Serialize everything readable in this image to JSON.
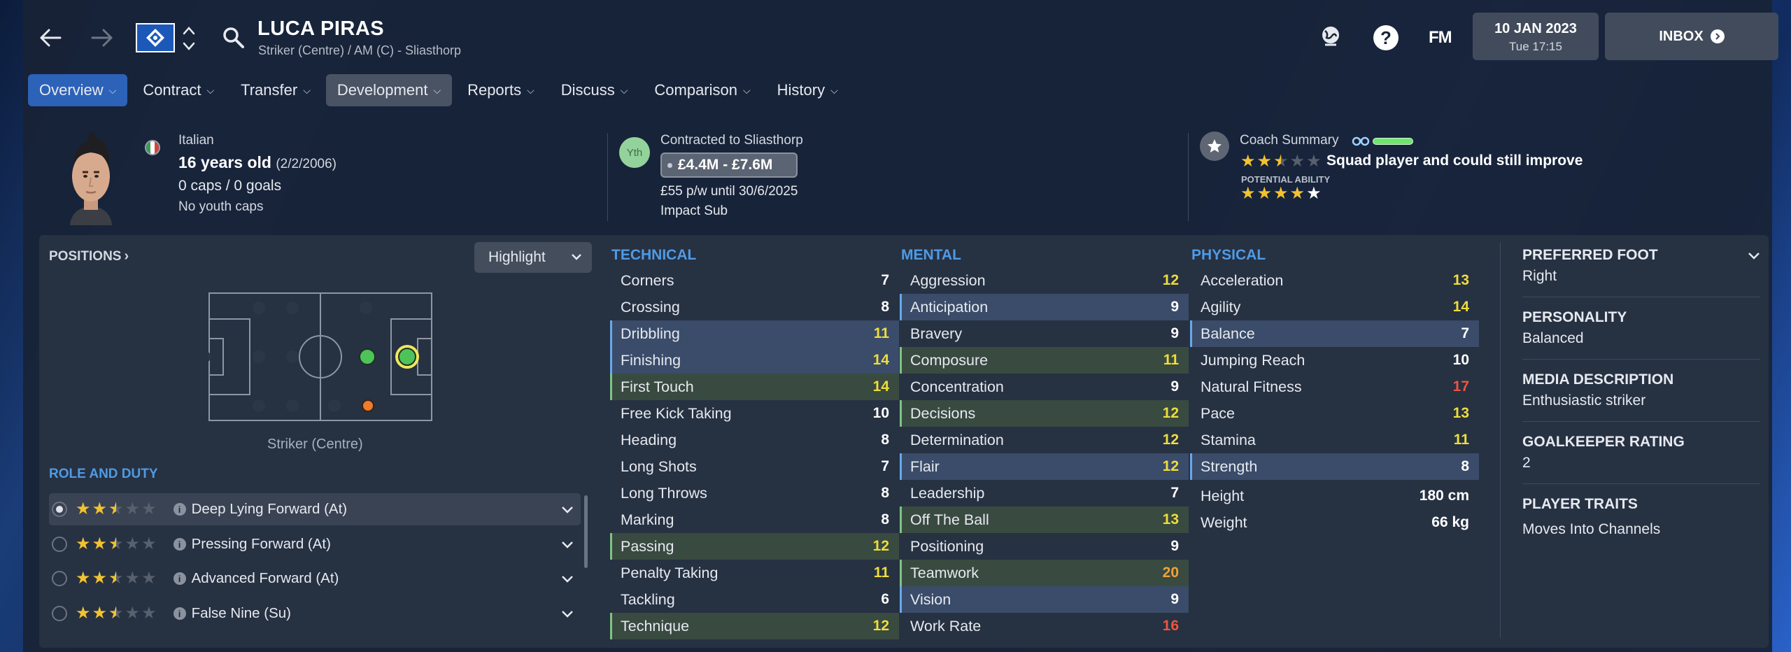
{
  "header": {
    "player_name": "LUCA PIRAS",
    "subtitle": "Striker (Centre) / AM (C) - Sliasthorp",
    "date": "10 JAN 2023",
    "time": "Tue 17:15",
    "inbox_label": "INBOX",
    "fm_label": "FM",
    "help_label": "?"
  },
  "nav": {
    "items": [
      "Overview",
      "Contract",
      "Transfer",
      "Development",
      "Reports",
      "Discuss",
      "Comparison",
      "History"
    ]
  },
  "profile": {
    "nationality": "Italian",
    "age": "16 years old",
    "dob": "(2/2/2006)",
    "caps": "0 caps / 0 goals",
    "youth_caps": "No youth caps"
  },
  "contract": {
    "badge": "Yth",
    "contracted_to": "Contracted to Sliasthorp",
    "value_range": "£4.4M - £7.6M",
    "wage": "£55 p/w until 30/6/2025",
    "role": "Impact Sub"
  },
  "coach": {
    "label": "Coach Summary",
    "summary": "Squad player and could still improve",
    "pa_label": "POTENTIAL ABILITY",
    "current_stars": 2.5,
    "potential_stars": 4.5
  },
  "positions": {
    "heading": "POSITIONS",
    "highlight_label": "Highlight",
    "caption": "Striker (Centre)"
  },
  "roles": {
    "heading": "ROLE AND DUTY",
    "items": [
      {
        "label": "Deep Lying Forward (At)",
        "stars": 2.5,
        "selected": true
      },
      {
        "label": "Pressing Forward (At)",
        "stars": 2.5,
        "selected": false
      },
      {
        "label": "Advanced Forward (At)",
        "stars": 2.5,
        "selected": false
      },
      {
        "label": "False Nine (Su)",
        "stars": 2.5,
        "selected": false
      }
    ]
  },
  "attributes": {
    "technical": {
      "heading": "TECHNICAL",
      "rows": [
        {
          "name": "Corners",
          "value": "7",
          "hl": "",
          "color": "white"
        },
        {
          "name": "Crossing",
          "value": "8",
          "hl": "",
          "color": "white"
        },
        {
          "name": "Dribbling",
          "value": "11",
          "hl": "blue",
          "color": "yellow"
        },
        {
          "name": "Finishing",
          "value": "14",
          "hl": "blue",
          "color": "yellow"
        },
        {
          "name": "First Touch",
          "value": "14",
          "hl": "green",
          "color": "yellow"
        },
        {
          "name": "Free Kick Taking",
          "value": "10",
          "hl": "",
          "color": "white"
        },
        {
          "name": "Heading",
          "value": "8",
          "hl": "",
          "color": "white"
        },
        {
          "name": "Long Shots",
          "value": "7",
          "hl": "",
          "color": "white"
        },
        {
          "name": "Long Throws",
          "value": "8",
          "hl": "",
          "color": "white"
        },
        {
          "name": "Marking",
          "value": "8",
          "hl": "",
          "color": "white"
        },
        {
          "name": "Passing",
          "value": "12",
          "hl": "green",
          "color": "yellow"
        },
        {
          "name": "Penalty Taking",
          "value": "11",
          "hl": "",
          "color": "yellow"
        },
        {
          "name": "Tackling",
          "value": "6",
          "hl": "",
          "color": "white"
        },
        {
          "name": "Technique",
          "value": "12",
          "hl": "green",
          "color": "yellow"
        }
      ]
    },
    "mental": {
      "heading": "MENTAL",
      "rows": [
        {
          "name": "Aggression",
          "value": "12",
          "hl": "",
          "color": "yellow"
        },
        {
          "name": "Anticipation",
          "value": "9",
          "hl": "blue",
          "color": "white"
        },
        {
          "name": "Bravery",
          "value": "9",
          "hl": "",
          "color": "white"
        },
        {
          "name": "Composure",
          "value": "11",
          "hl": "green",
          "color": "yellow"
        },
        {
          "name": "Concentration",
          "value": "9",
          "hl": "",
          "color": "white"
        },
        {
          "name": "Decisions",
          "value": "12",
          "hl": "green",
          "color": "yellow"
        },
        {
          "name": "Determination",
          "value": "12",
          "hl": "",
          "color": "yellow"
        },
        {
          "name": "Flair",
          "value": "12",
          "hl": "blue",
          "color": "yellow"
        },
        {
          "name": "Leadership",
          "value": "7",
          "hl": "",
          "color": "white"
        },
        {
          "name": "Off The Ball",
          "value": "13",
          "hl": "green",
          "color": "yellow"
        },
        {
          "name": "Positioning",
          "value": "9",
          "hl": "",
          "color": "white"
        },
        {
          "name": "Teamwork",
          "value": "20",
          "hl": "green",
          "color": "orange"
        },
        {
          "name": "Vision",
          "value": "9",
          "hl": "blue",
          "color": "white"
        },
        {
          "name": "Work Rate",
          "value": "16",
          "hl": "",
          "color": "red"
        }
      ]
    },
    "physical": {
      "heading": "PHYSICAL",
      "rows": [
        {
          "name": "Acceleration",
          "value": "13",
          "hl": "",
          "color": "yellow"
        },
        {
          "name": "Agility",
          "value": "14",
          "hl": "",
          "color": "yellow"
        },
        {
          "name": "Balance",
          "value": "7",
          "hl": "blue",
          "color": "white"
        },
        {
          "name": "Jumping Reach",
          "value": "10",
          "hl": "",
          "color": "white"
        },
        {
          "name": "Natural Fitness",
          "value": "17",
          "hl": "",
          "color": "red"
        },
        {
          "name": "Pace",
          "value": "13",
          "hl": "",
          "color": "yellow"
        },
        {
          "name": "Stamina",
          "value": "11",
          "hl": "",
          "color": "yellow"
        },
        {
          "name": "Strength",
          "value": "8",
          "hl": "blue",
          "color": "white"
        }
      ],
      "height_label": "Height",
      "height_value": "180 cm",
      "weight_label": "Weight",
      "weight_value": "66 kg"
    }
  },
  "sidebar": {
    "preferred_foot_label": "PREFERRED FOOT",
    "preferred_foot": "Right",
    "personality_label": "PERSONALITY",
    "personality": "Balanced",
    "media_label": "MEDIA DESCRIPTION",
    "media": "Enthusiastic striker",
    "gk_label": "GOALKEEPER RATING",
    "gk": "2",
    "traits_label": "PLAYER TRAITS",
    "traits": "Moves Into Channels"
  },
  "colors": {
    "accent_blue": "#4f9be6",
    "active_tab": "#2c62b8",
    "yellow": "#efdd3c",
    "orange": "#f2a13a",
    "red": "#ee5540",
    "star": "#f2c230"
  }
}
